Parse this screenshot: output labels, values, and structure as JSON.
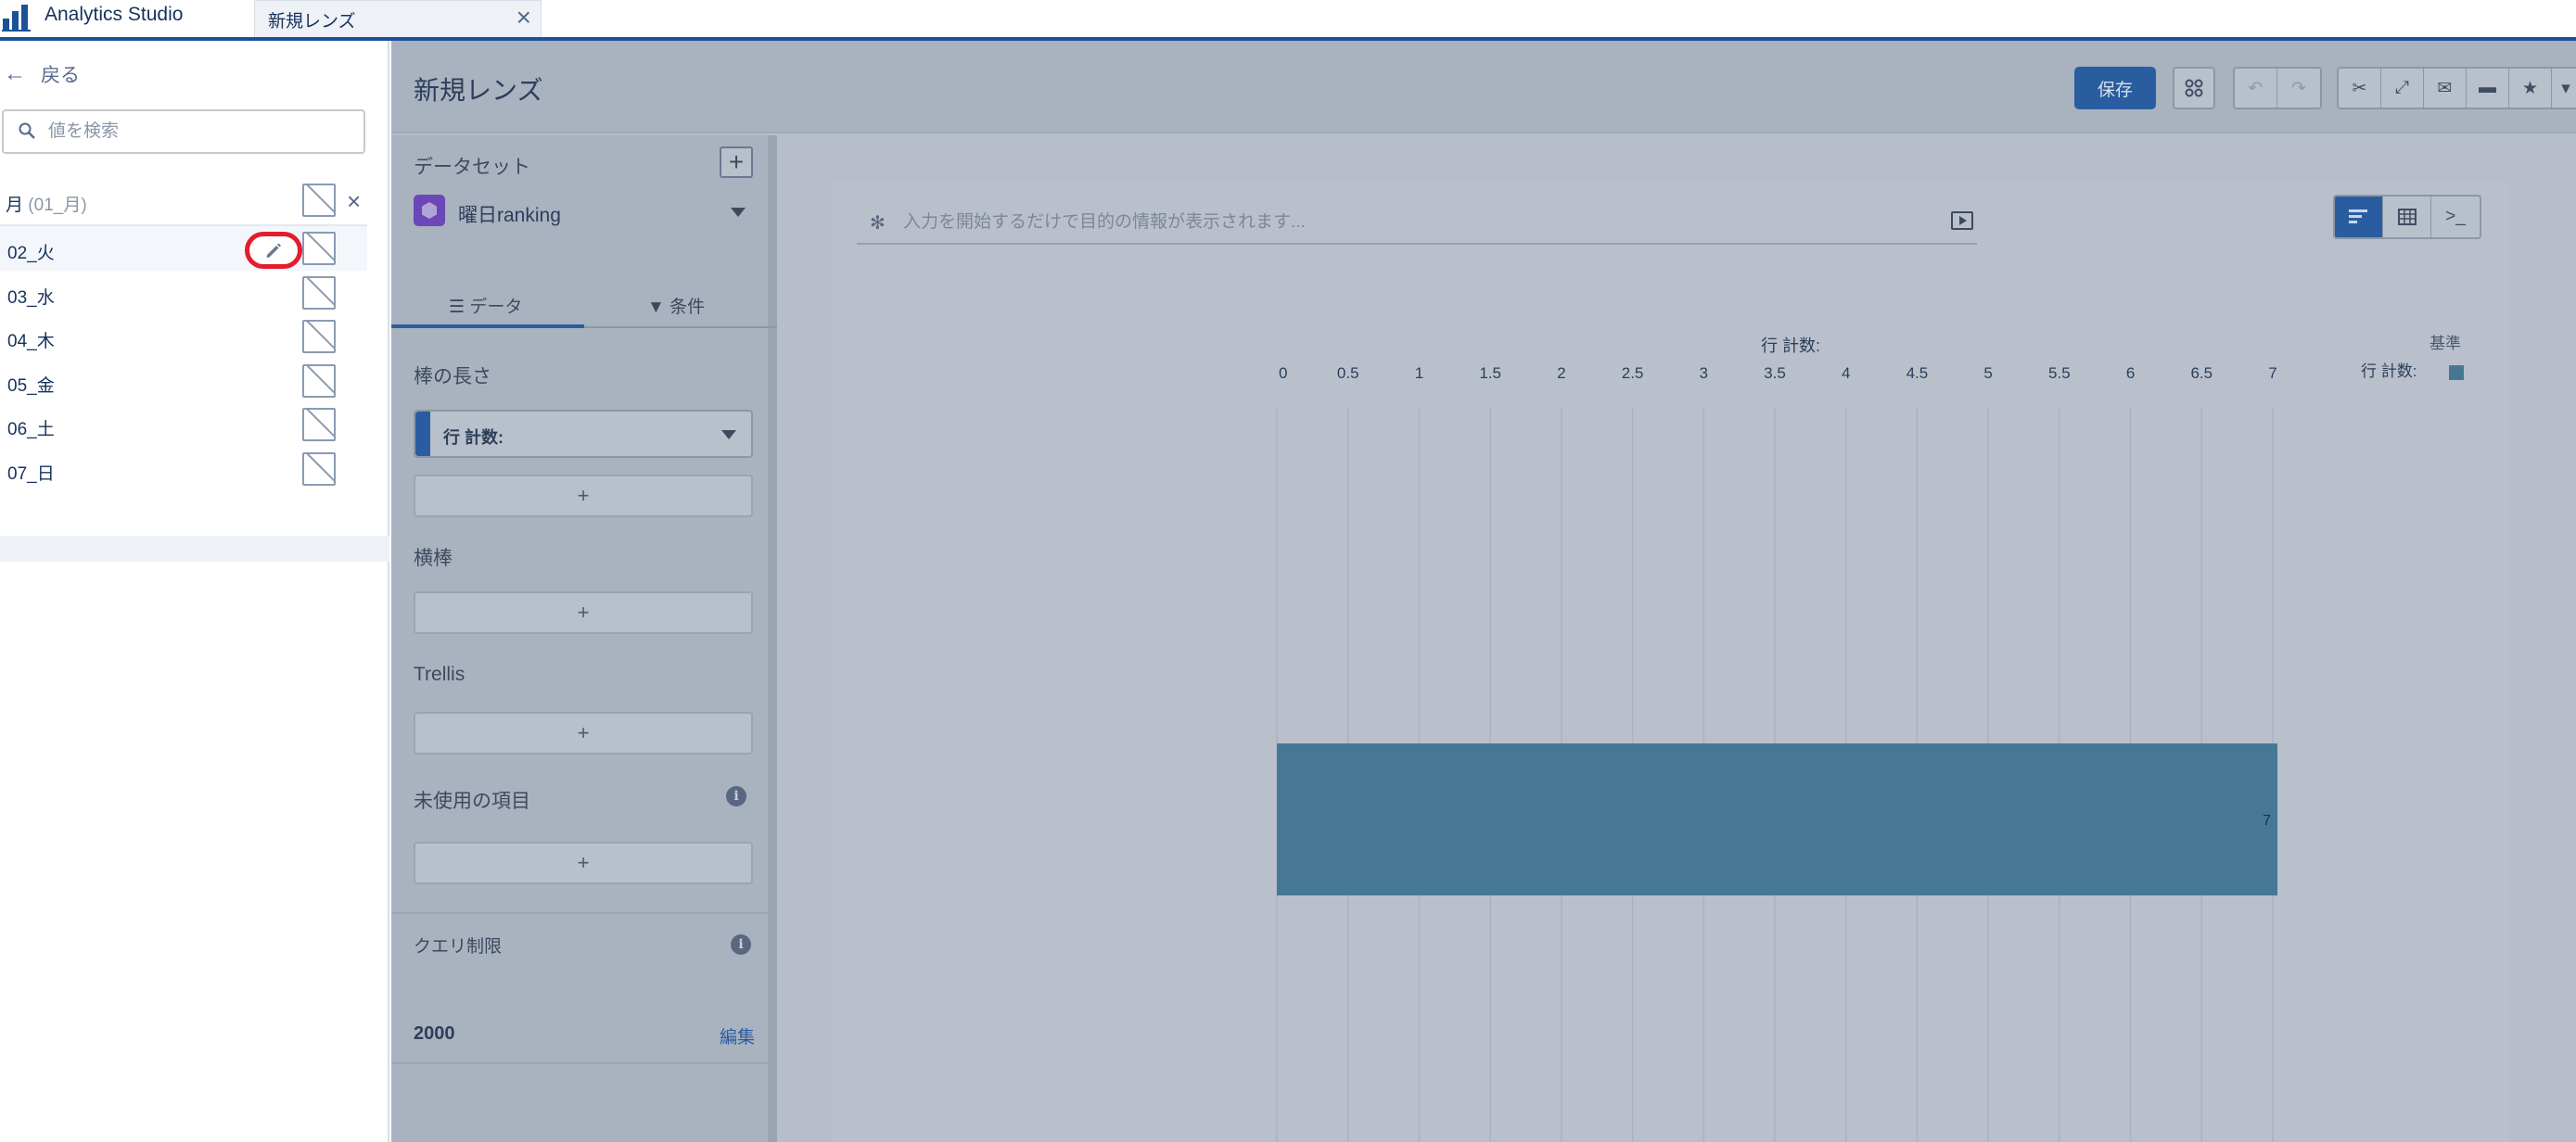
{
  "tabs": {
    "app_title": "Analytics Studio",
    "doc_title": "新規レンズ"
  },
  "filter_panel": {
    "back_label": "戻る",
    "search_placeholder": "値を検索",
    "filter_label": "月",
    "filter_value": "(01_月)",
    "values": [
      "02_火",
      "03_水",
      "04_木",
      "05_金",
      "06_土",
      "07_日"
    ]
  },
  "lens": {
    "title": "新規レンズ",
    "save_label": "保存",
    "dataset_section": "データセット",
    "dataset_name": "曜日ranking",
    "tab_data": "データ",
    "tab_filters": "条件",
    "bar_length_section": "棒の長さ",
    "bar_length_field": "行 計数:",
    "bars_section": "横棒",
    "trellis_section": "Trellis",
    "unused_section": "未使用の項目",
    "query_limit_section": "クエリ制限",
    "query_limit_value": "2000",
    "edit_label": "編集",
    "query_placeholder": "入力を開始するだけで目的の情報が表示されます...",
    "legend_title": "基準",
    "legend_item": "行 計数:",
    "colors": {
      "bar": "#467896",
      "save_button": "#2a5da0",
      "highlight_ring": "#e41c2b"
    }
  },
  "chart_data": {
    "type": "bar",
    "orientation": "horizontal",
    "categories": [
      ""
    ],
    "series": [
      {
        "name": "行 計数:",
        "values": [
          7
        ]
      }
    ],
    "title": "行 計数:",
    "xlabel": "行 計数:",
    "xlim": [
      0,
      7
    ],
    "ticks": [
      "0",
      "0.5",
      "1",
      "1.5",
      "2",
      "2.5",
      "3",
      "3.5",
      "4",
      "4.5",
      "5",
      "5.5",
      "6",
      "6.5",
      "7"
    ],
    "data_labels": [
      "7"
    ],
    "grid": true,
    "legend": "top-right"
  }
}
